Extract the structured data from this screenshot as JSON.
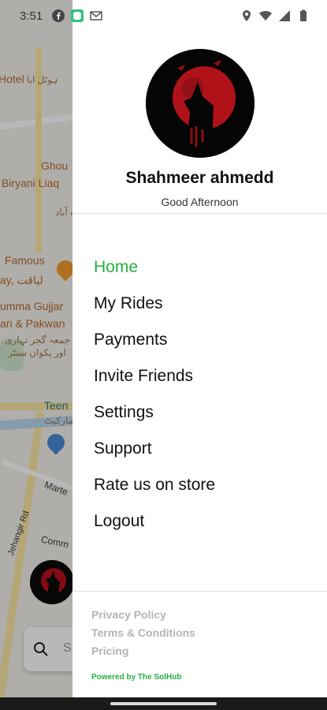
{
  "status_bar": {
    "time": "3:51",
    "left_icons": [
      "facebook-icon",
      "messaging-app-icon",
      "gmail-icon"
    ],
    "right_icons": [
      "location-icon",
      "wifi-icon",
      "signal-icon",
      "battery-icon"
    ]
  },
  "map": {
    "labels": [
      "Hotel",
      "ہوٹل ابا",
      "Ghou",
      "Biryani Liaq",
      "لیاقت آباد",
      "Famous",
      "ay, لیاقت",
      "umma Gujjar",
      "ari & Pakwan",
      "جمعہ گجر نہاری",
      "اور پکوان سنٹر",
      "Teen",
      "مارکیٹ",
      "Marte",
      "Jehangir Rd",
      "Comm"
    ],
    "search_placeholder": "S"
  },
  "drawer": {
    "profile": {
      "name": "Shahmeer ahmedd",
      "greeting": "Good Afternoon"
    },
    "menu": [
      {
        "label": "Home",
        "active": true
      },
      {
        "label": "My Rides",
        "active": false
      },
      {
        "label": "Payments",
        "active": false
      },
      {
        "label": "Invite Friends",
        "active": false
      },
      {
        "label": "Settings",
        "active": false
      },
      {
        "label": "Support",
        "active": false
      },
      {
        "label": "Rate us on store",
        "active": false
      },
      {
        "label": "Logout",
        "active": false
      }
    ],
    "footer": {
      "links": [
        "Privacy Policy",
        "Terms & Conditions",
        "Pricing"
      ],
      "powered_by": "Powered by The SolHub"
    }
  },
  "colors": {
    "accent": "#27b03f",
    "footer_link": "#b5b5b5"
  }
}
